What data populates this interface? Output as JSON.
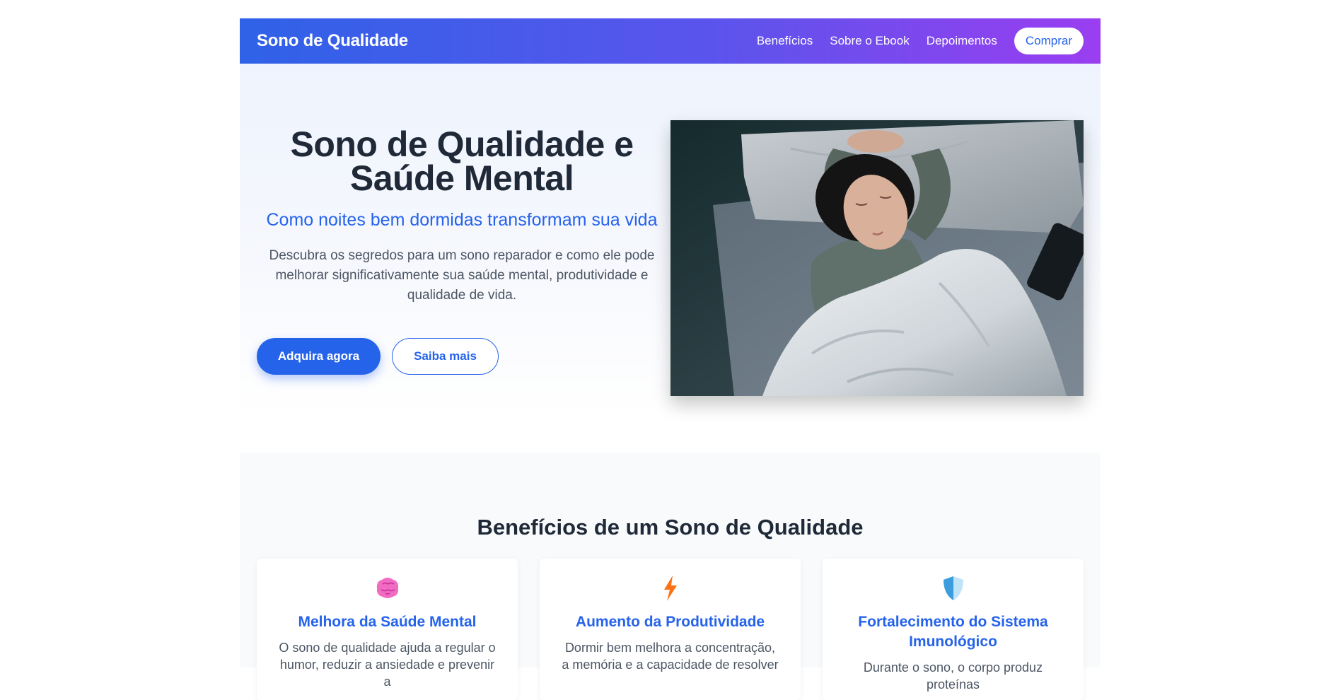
{
  "navbar": {
    "brand": "Sono de Qualidade",
    "links": [
      "Benefícios",
      "Sobre o Ebook",
      "Depoimentos"
    ],
    "cta": "Comprar"
  },
  "hero": {
    "title": "Sono de Qualidade e Saúde Mental",
    "subtitle": "Como noites bem dormidas transformam sua vida",
    "description": "Descubra os segredos para um sono reparador e como ele pode melhorar significativamente sua saúde mental, produtividade e qualidade de vida.",
    "primary_button": "Adquira agora",
    "secondary_button": "Saiba mais"
  },
  "benefits": {
    "title": "Benefícios de um Sono de Qualidade",
    "cards": [
      {
        "icon": "brain-icon",
        "title": "Melhora da Saúde Mental",
        "text": "O sono de qualidade ajuda a regular o humor, reduzir a ansiedade e prevenir a"
      },
      {
        "icon": "lightning-icon",
        "title": "Aumento da Produtividade",
        "text": "Dormir bem melhora a concentração, a memória e a capacidade de resolver"
      },
      {
        "icon": "shield-icon",
        "title": "Fortalecimento do Sistema Imunológico",
        "text": "Durante o sono, o corpo produz proteínas"
      }
    ]
  },
  "colors": {
    "accent": "#2563eb",
    "gradient_start": "#2f62e8",
    "gradient_end": "#9a3ef0"
  }
}
